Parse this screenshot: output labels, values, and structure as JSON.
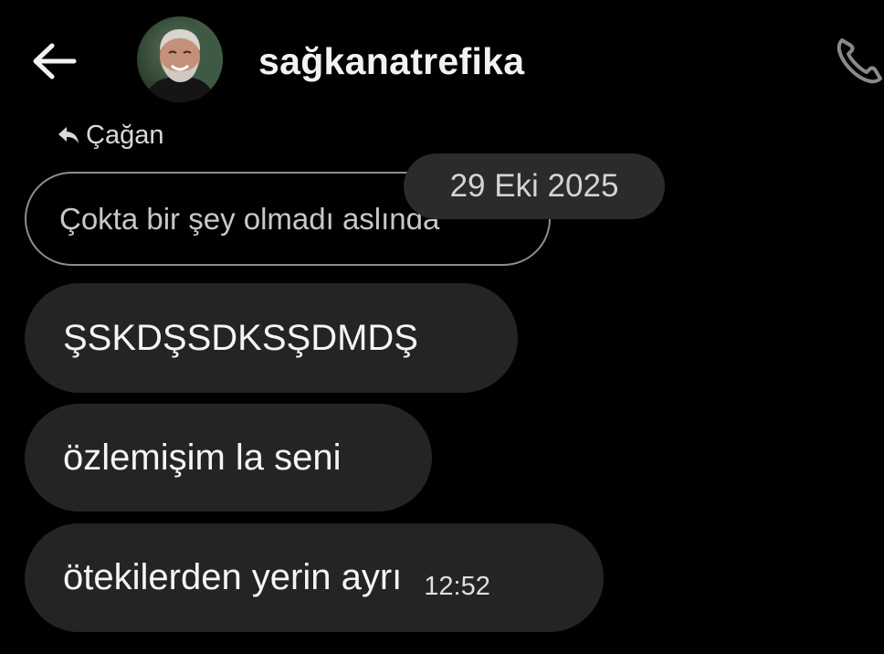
{
  "header": {
    "username": "sağkanatrefika",
    "back_icon": "arrow-left-icon",
    "call_icon": "phone-icon"
  },
  "reply": {
    "label": "Çağan",
    "icon": "reply-arrow-icon",
    "quoted_text": "Çokta bir şey olmadı aslında",
    "date": "29 Eki 2025"
  },
  "messages": [
    {
      "text": "ŞSKDŞSDKSŞDMDŞ"
    },
    {
      "text": "özlemişim la seni"
    },
    {
      "text": "ötekilerden yerin ayrı",
      "time": "12:52"
    }
  ],
  "colors": {
    "background": "#000000",
    "bubble": "#242424",
    "date_pill": "#2b2b2b",
    "quoted_border": "#8e8e8e",
    "text": "#f5f5f5"
  }
}
